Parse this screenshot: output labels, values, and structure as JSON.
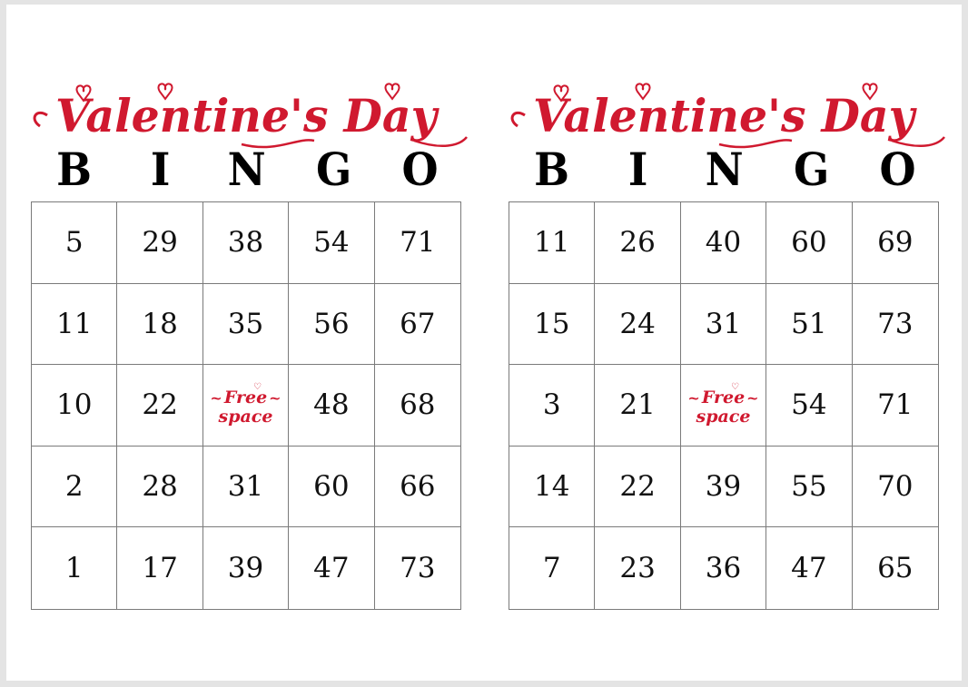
{
  "accent_color": "#d0192f",
  "cards": [
    {
      "title": "Valentine's Day",
      "header": [
        "B",
        "I",
        "N",
        "G",
        "O"
      ],
      "rows": [
        [
          "5",
          "29",
          "38",
          "54",
          "71"
        ],
        [
          "11",
          "18",
          "35",
          "56",
          "67"
        ],
        [
          "10",
          "22",
          "FREE",
          "48",
          "68"
        ],
        [
          "2",
          "28",
          "31",
          "60",
          "66"
        ],
        [
          "1",
          "17",
          "39",
          "47",
          "73"
        ]
      ],
      "free_space": {
        "line1": "Free",
        "line2": "space"
      }
    },
    {
      "title": "Valentine's Day",
      "header": [
        "B",
        "I",
        "N",
        "G",
        "O"
      ],
      "rows": [
        [
          "11",
          "26",
          "40",
          "60",
          "69"
        ],
        [
          "15",
          "24",
          "31",
          "51",
          "73"
        ],
        [
          "3",
          "21",
          "FREE",
          "54",
          "71"
        ],
        [
          "14",
          "22",
          "39",
          "55",
          "70"
        ],
        [
          "7",
          "23",
          "36",
          "47",
          "65"
        ]
      ],
      "free_space": {
        "line1": "Free",
        "line2": "space"
      }
    }
  ]
}
